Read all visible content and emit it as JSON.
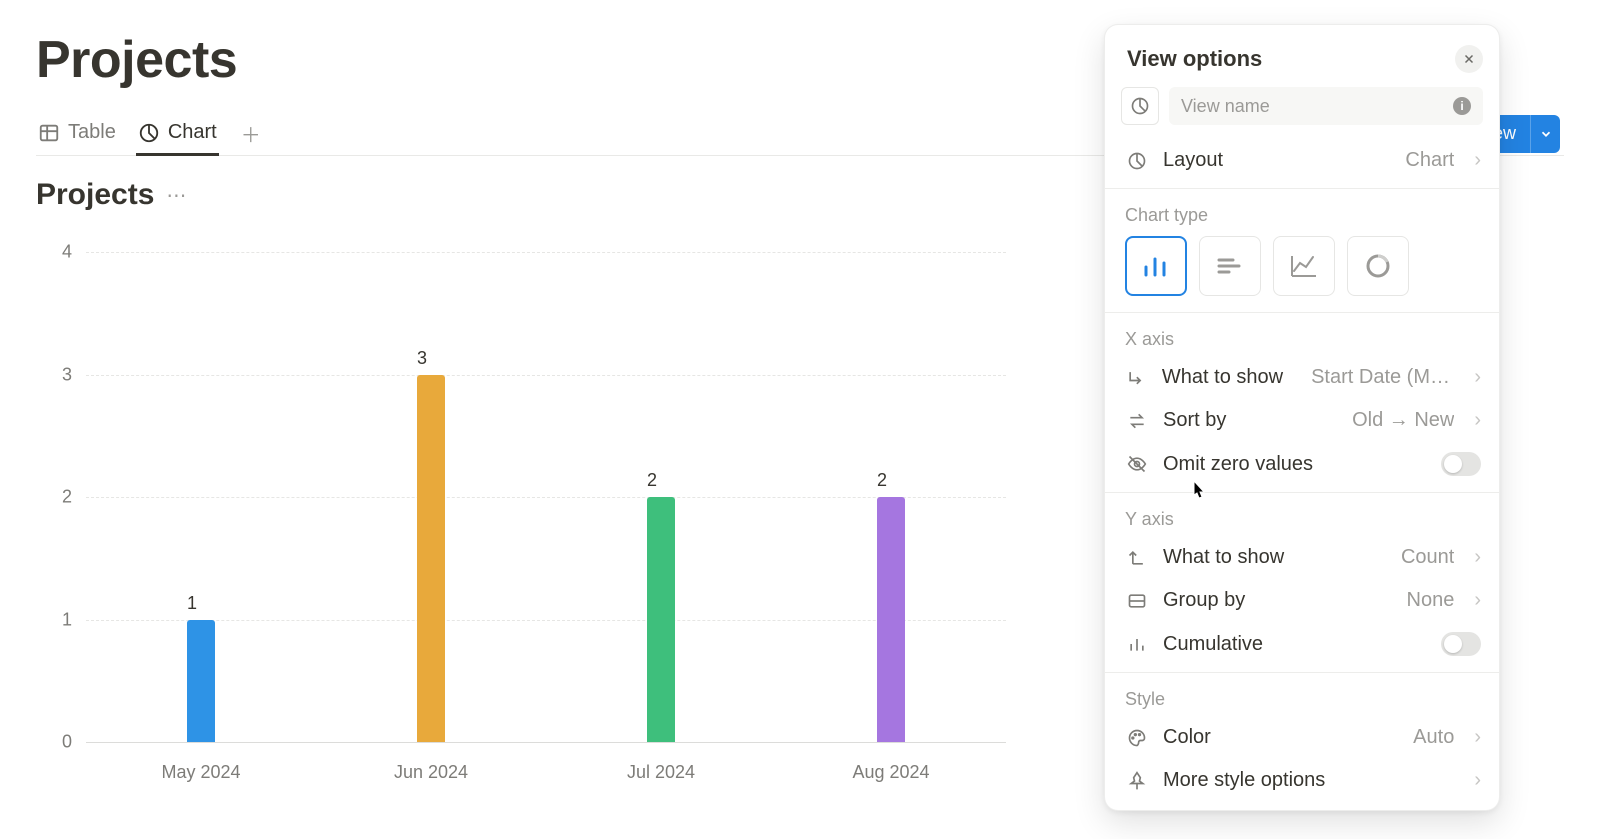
{
  "page": {
    "title": "Projects",
    "chart_title": "Projects"
  },
  "tabs": [
    {
      "label": "Table",
      "icon": "table-icon",
      "active": false
    },
    {
      "label": "Chart",
      "icon": "chart-icon",
      "active": true
    }
  ],
  "toolbar": {
    "new_label": "New"
  },
  "view_options": {
    "title": "View options",
    "view_name_placeholder": "View name",
    "layout_label": "Layout",
    "layout_value": "Chart",
    "chart_type_label": "Chart type",
    "chart_types": [
      "vertical-bar",
      "horizontal-bar",
      "line",
      "donut"
    ],
    "selected_chart_type": "vertical-bar",
    "x_axis": {
      "section": "X axis",
      "what_to_show_label": "What to show",
      "what_to_show_value": "Start Date (Mo…",
      "sort_by_label": "Sort by",
      "sort_by_value": "Old → New",
      "omit_zero_label": "Omit zero values",
      "omit_zero_on": false
    },
    "y_axis": {
      "section": "Y axis",
      "what_to_show_label": "What to show",
      "what_to_show_value": "Count",
      "group_by_label": "Group by",
      "group_by_value": "None",
      "cumulative_label": "Cumulative",
      "cumulative_on": false
    },
    "style": {
      "section": "Style",
      "color_label": "Color",
      "color_value": "Auto",
      "more_label": "More style options"
    }
  },
  "chart_data": {
    "type": "bar",
    "title": "Projects",
    "xlabel": "",
    "ylabel": "",
    "categories": [
      "May 2024",
      "Jun 2024",
      "Jul 2024",
      "Aug 2024"
    ],
    "values": [
      1,
      3,
      2,
      2
    ],
    "colors": [
      "#2e93e6",
      "#e8a93b",
      "#3ebf7c",
      "#a576e0"
    ],
    "ylim": [
      0,
      4
    ],
    "y_ticks": [
      0,
      1,
      2,
      3,
      4
    ]
  }
}
